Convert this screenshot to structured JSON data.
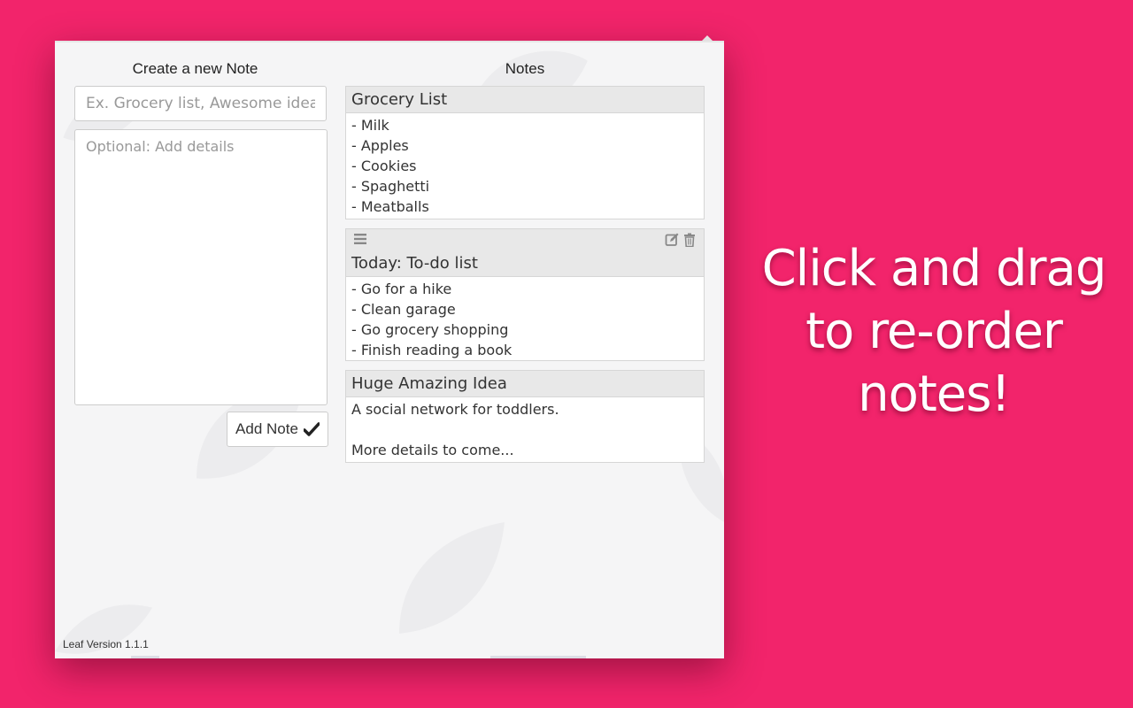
{
  "create": {
    "heading": "Create a new Note",
    "title_placeholder": "Ex. Grocery list, Awesome idea",
    "details_placeholder": "Optional: Add details",
    "add_button_label": "Add Note"
  },
  "notes_panel": {
    "heading": "Notes",
    "notes": [
      {
        "title": "Grocery List",
        "lines": [
          "- Milk",
          "- Apples",
          "- Cookies",
          "- Spaghetti",
          "- Meatballs"
        ]
      },
      {
        "title": "Today: To-do list",
        "lines": [
          "- Go for a hike",
          "- Clean garage",
          "- Go grocery shopping",
          "- Finish reading a book"
        ]
      },
      {
        "title": "Huge Amazing Idea",
        "lines": [
          "A social network for toddlers.",
          "",
          "More details to come..."
        ]
      }
    ]
  },
  "footer": {
    "version": "Leaf Version 1.1.1"
  },
  "promo": {
    "lines": [
      "Click and drag",
      "to re-order",
      "notes!"
    ]
  },
  "icons": {
    "drag": "drag-handle-icon",
    "edit": "edit-icon",
    "delete": "trash-icon",
    "check": "check-icon",
    "background": "leaf-icon"
  },
  "colors": {
    "background": "#f2246b",
    "panel": "#f5f5f6",
    "note_header": "#e8e8e8"
  }
}
